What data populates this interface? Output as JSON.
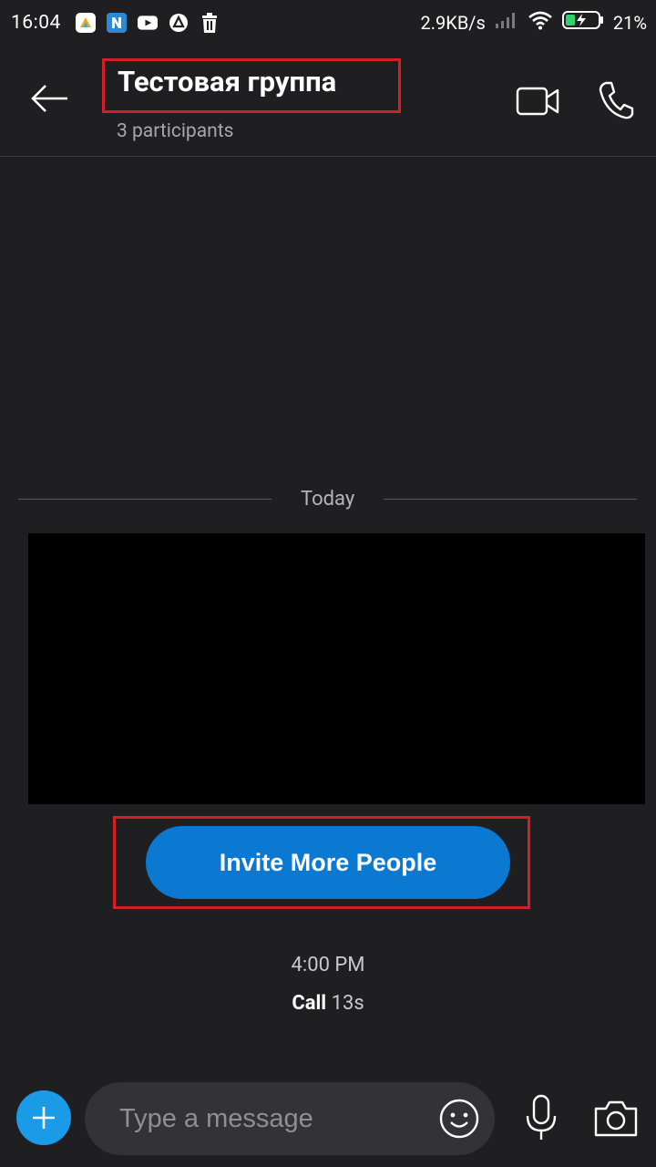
{
  "status_bar": {
    "time": "16:04",
    "network_speed": "2.9KB/s",
    "battery_percent": "21%",
    "notification_icons": [
      "colorful-app-icon",
      "n-app-icon",
      "youtube-icon",
      "vpn-icon",
      "trash-icon"
    ]
  },
  "header": {
    "title": "Тестовая группа",
    "participants": "3 participants"
  },
  "conversation": {
    "date_separator": "Today",
    "invite_button_label": "Invite More People",
    "call_time": "4:00 PM",
    "call_label": "Call",
    "call_duration": "13s"
  },
  "composer": {
    "placeholder": "Type a message"
  },
  "colors": {
    "background": "#1f1f21",
    "accent_blue": "#0b78d1",
    "plus_blue": "#1a9be8",
    "highlight_red": "#d32027"
  }
}
